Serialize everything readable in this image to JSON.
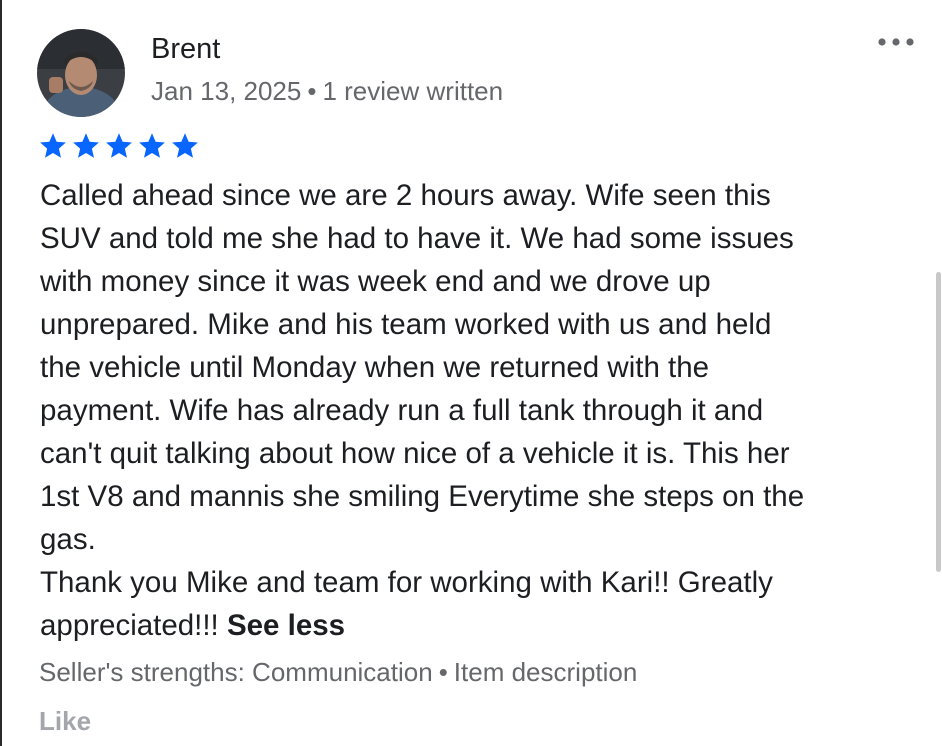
{
  "reviewer": {
    "name": "Brent",
    "date": "Jan 13, 2025",
    "separator": "•",
    "review_count": "1 review written"
  },
  "rating": {
    "stars": 5,
    "max": 5,
    "star_color": "#0866ff"
  },
  "review": {
    "lines": [
      "Called ahead since we are 2 hours away. Wife seen this",
      "SUV and told me she had to have it. We had some issues",
      "with money since it was week end and we drove up",
      "unprepared. Mike and his team worked with us and held",
      "the vehicle until Monday when we returned with the",
      "payment. Wife has already run a full tank through it and",
      "can't quit talking about how nice of a vehicle it is. This her",
      "1st V8 and mannis she smiling Everytime she steps on the",
      "gas."
    ],
    "closing_line_1": "Thank you Mike and team for working with Kari!! Greatly",
    "closing_line_2": "appreciated!!!",
    "see_less_label": "See less"
  },
  "strengths": {
    "label": "Seller's strengths: Communication",
    "separator": "•",
    "item": "Item description"
  },
  "actions": {
    "like_label": "Like"
  },
  "icons": {
    "more": "more-horizontal-icon",
    "star": "star-icon"
  }
}
